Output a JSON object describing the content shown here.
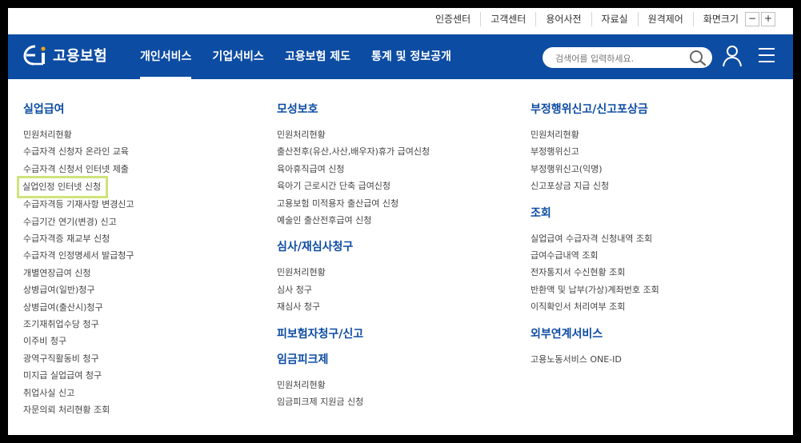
{
  "utility": {
    "links": [
      "인증센터",
      "고객센터",
      "용어사전",
      "자료실",
      "원격제어"
    ],
    "zoom_label": "화면크기",
    "zoom_minus": "−",
    "zoom_plus": "+"
  },
  "header": {
    "logo_text": "고용보험",
    "nav": [
      "개인서비스",
      "기업서비스",
      "고용보험 제도",
      "통계 및 정보공개"
    ],
    "active_nav": "개인서비스",
    "search_placeholder": "검색어를 입력하세요.",
    "brand_color": "#0d4ca3"
  },
  "sitemap": {
    "col1": [
      {
        "title": "실업급여",
        "items": [
          "민원처리현황",
          "수급자격 신청자 온라인 교육",
          "수급자격 신청서 인터넷 제출",
          "실업인정 인터넷 신청",
          "수급자격등 기재사항 변경신고",
          "수급기간 연기(변경) 신고",
          "수급자격증 재교부 신청",
          "수급자격 인정명세서 발급청구",
          "개별연장급여 신청",
          "상병급여(일반)청구",
          "상병급여(출산시)청구",
          "조기재취업수당 청구",
          "이주비 청구",
          "광역구직활동비 청구",
          "미지급 실업급여 청구",
          "취업사실 신고",
          "자문의뢰 처리현황 조회"
        ],
        "highlighted": "실업인정 인터넷 신청"
      }
    ],
    "col2": [
      {
        "title": "모성보호",
        "items": [
          "민원처리현황",
          "출산전후(유산,사산,배우자)휴가 급여신청",
          "육아휴직급여 신청",
          "육아기 근로시간 단축 급여신청",
          "고용보험 미적용자 출산급여 신청",
          "예술인 출산전후급여 신청"
        ]
      },
      {
        "title": "심사/재심사청구",
        "items": [
          "민원처리현황",
          "심사 청구",
          "재심사 청구"
        ]
      },
      {
        "title": "피보험자청구/신고",
        "items": []
      },
      {
        "title": "임금피크제",
        "items": [
          "민원처리현황",
          "임금피크제 지원금 신청"
        ]
      }
    ],
    "col3": [
      {
        "title": "부정행위신고/신고포상금",
        "items": [
          "민원처리현황",
          "부정행위신고",
          "부정행위신고(익명)",
          "신고포상금 지급 신청"
        ]
      },
      {
        "title": "조회",
        "items": [
          "실업급여 수급자격 신청내역 조회",
          "급여수급내역 조회",
          "전자통지서 수신현황 조회",
          "반환액 및 납부(가상)계좌번호 조회",
          "이직확인서 처리여부 조회"
        ]
      },
      {
        "title": "외부연계서비스",
        "items": [
          "고용노동서비스 ONE-ID"
        ]
      }
    ],
    "highlight_color": "#cfe37c"
  }
}
